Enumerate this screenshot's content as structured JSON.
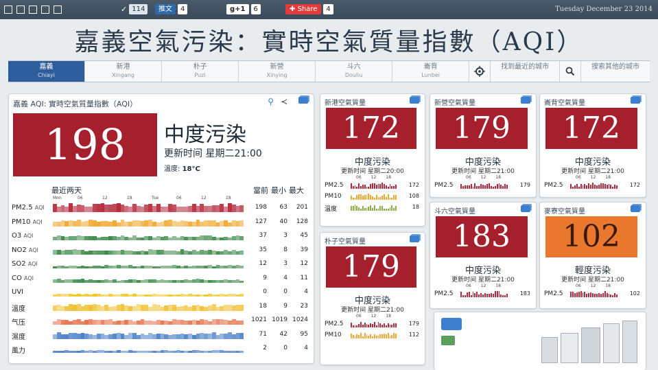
{
  "topbar": {
    "count_114": "114",
    "tweet_label": "推文",
    "tweet_count": "4",
    "gplus_label": "g+1",
    "gplus_count": "6",
    "share_label": "Share",
    "share_count": "4",
    "date": "Tuesday December 23 2014"
  },
  "title": "嘉義空氣污染：實時空氣質量指數（AQI）",
  "nav": [
    {
      "zh": "嘉義",
      "en": "Chiayi",
      "active": true
    },
    {
      "zh": "新港",
      "en": "Xingang"
    },
    {
      "zh": "朴子",
      "en": "Puzi"
    },
    {
      "zh": "新營",
      "en": "Xinying"
    },
    {
      "zh": "斗六",
      "en": "Douliu"
    },
    {
      "zh": "崙背",
      "en": "Lunbei"
    }
  ],
  "nav_extra": {
    "nearest_label": "找到最近的城市",
    "search_label": "搜索其他的城市"
  },
  "main": {
    "title": "嘉義 AQI: 實時空氣質量指數（AQI）",
    "aqi": "198",
    "status": "中度污染",
    "update": "更新时间 星期二21:00",
    "temp_label": "溫度:",
    "temp_value": "18°C",
    "history_label": "最近两天",
    "col_headers": [
      "當前",
      "最小",
      "最大"
    ],
    "days": [
      "Mon",
      "06",
      "12",
      "18",
      "Tue",
      "06",
      "12",
      "18"
    ],
    "rows": [
      {
        "label": "PM2.5",
        "unit": "AQI",
        "cur": "198",
        "min": "63",
        "max": "201",
        "color": "#b3283a",
        "fill": 0.95
      },
      {
        "label": "PM10",
        "unit": "AQI",
        "cur": "127",
        "min": "40",
        "max": "128",
        "color": "#f0a830",
        "fill": 0.75
      },
      {
        "label": "O3",
        "unit": "AQI",
        "cur": "37",
        "min": "3",
        "max": "45",
        "color": "#3d8a4a",
        "fill": 0.5
      },
      {
        "label": "NO2",
        "unit": "AQI",
        "cur": "35",
        "min": "8",
        "max": "39",
        "color": "#3d8a4a",
        "fill": 0.55
      },
      {
        "label": "SO2",
        "unit": "AQI",
        "cur": "12",
        "min": "3",
        "max": "12",
        "color": "#3d8a4a",
        "fill": 0.35
      },
      {
        "label": "CO",
        "unit": "AQI",
        "cur": "9",
        "min": "4",
        "max": "11",
        "color": "#3d8a4a",
        "fill": 0.4
      },
      {
        "label": "UVI",
        "unit": "",
        "cur": "0",
        "min": "0",
        "max": "4",
        "color": "#f0c420",
        "fill": 0.3
      },
      {
        "label": "溫度",
        "unit": "",
        "cur": "18",
        "min": "9",
        "max": "23",
        "color": "#f0c030",
        "fill": 0.7
      },
      {
        "label": "气压",
        "unit": "",
        "cur": "1021",
        "min": "1019",
        "max": "1024",
        "color": "#e8704a",
        "fill": 0.6
      },
      {
        "label": "濕度",
        "unit": "",
        "cur": "71",
        "min": "42",
        "max": "95",
        "color": "#4a7fc8",
        "fill": 0.7
      },
      {
        "label": "風力",
        "unit": "",
        "cur": "2",
        "min": "0",
        "max": "4",
        "color": "#4a7fc8",
        "fill": 0.3
      }
    ]
  },
  "stations": [
    {
      "title": "新港空氣質量",
      "aqi": "172",
      "status": "中度污染",
      "update": "更新时间 星期二20:00",
      "rows": [
        {
          "label": "PM2.5",
          "val": "172"
        },
        {
          "label": "PM10",
          "val": "108"
        },
        {
          "label": "溫度",
          "val": "18"
        }
      ]
    },
    {
      "title": "朴子空氣質量",
      "aqi": "179",
      "status": "中度污染",
      "update": "更新时间 星期二21:00",
      "rows": [
        {
          "label": "PM2.5",
          "val": "179"
        },
        {
          "label": "PM10",
          "val": "112"
        }
      ]
    },
    {
      "title": "新營空氣質量",
      "aqi": "179",
      "status": "中度污染",
      "update": "更新时间 星期二21:00",
      "rows": [
        {
          "label": "PM2.5",
          "val": "179"
        }
      ]
    },
    {
      "title": "崙背空氣質量",
      "aqi": "172",
      "status": "中度污染",
      "update": "更新时间 星期二21:00",
      "rows": [
        {
          "label": "PM2.5",
          "val": "172"
        }
      ]
    },
    {
      "title": "斗六空氣質量",
      "aqi": "183",
      "status": "中度污染",
      "update": "更新时间 星期二21:00",
      "rows": [
        {
          "label": "PM2.5",
          "val": "183"
        }
      ]
    },
    {
      "title": "麥寮空氣質量",
      "aqi": "102",
      "status": "輕度污染",
      "update": "更新时间 星期二21:00",
      "rows": [
        {
          "label": "PM2.5",
          "val": "102"
        }
      ]
    }
  ],
  "mini_ticks": [
    "06",
    "12",
    "18"
  ],
  "colors": {
    "red": "#a5202c",
    "orange": "#e9772e",
    "accent": "#2d5e9b"
  }
}
